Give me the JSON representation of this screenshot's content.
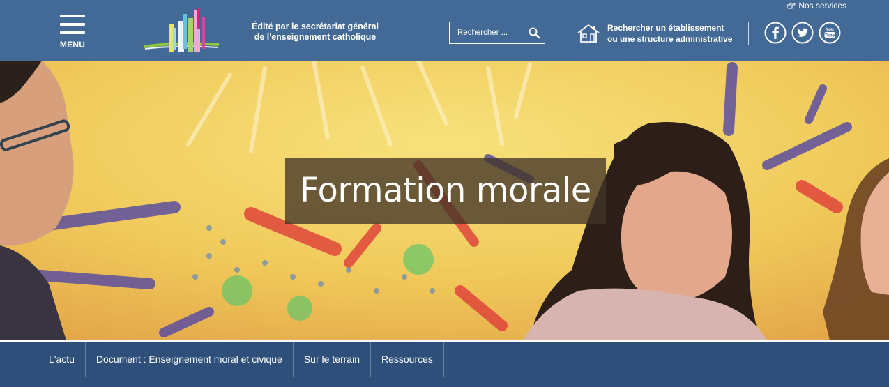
{
  "header": {
    "services_label": "Nos services",
    "menu_label": "MENU",
    "tagline_line1": "Édité par le secrétariat général",
    "tagline_line2": "de l'enseignement catholique",
    "search": {
      "placeholder": "Rechercher ..."
    },
    "etablissement_line1": "Rechercher un établissement",
    "etablissement_line2": "ou une structure administrative",
    "social": [
      "facebook-icon",
      "twitter-icon",
      "youtube-icon"
    ],
    "bg_color": "#436996"
  },
  "hero": {
    "title": "Formation morale"
  },
  "subnav": {
    "items": [
      {
        "label": "L'actu"
      },
      {
        "label": "Document : Enseignement moral et civique"
      },
      {
        "label": "Sur le terrain"
      },
      {
        "label": "Ressources"
      }
    ],
    "bg_color": "#2e4f7a"
  }
}
